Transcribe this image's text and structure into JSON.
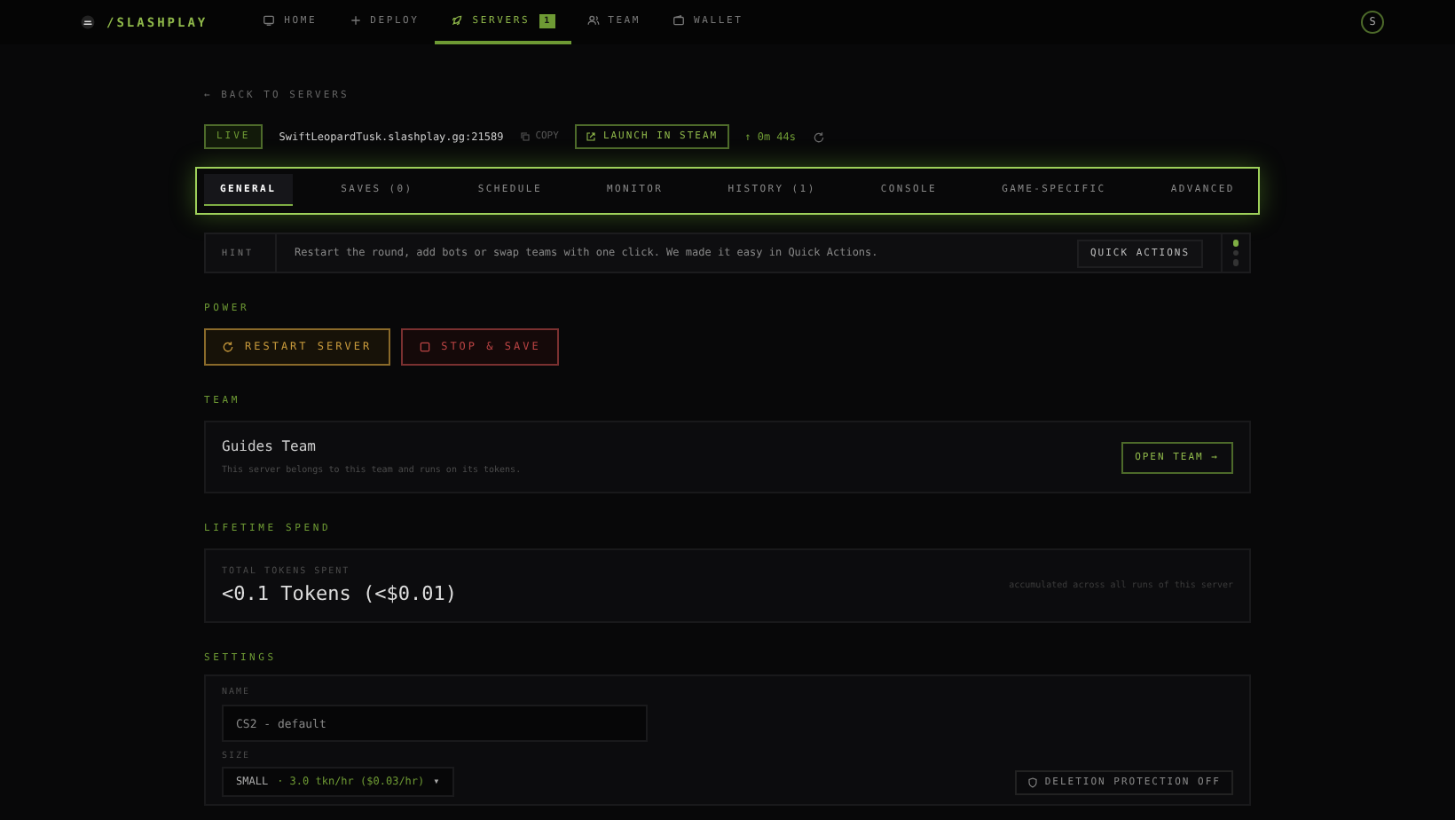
{
  "nav": {
    "brand": "/SLASHPLAY",
    "items": [
      {
        "label": "HOME",
        "selected": false
      },
      {
        "label": "DEPLOY",
        "selected": false
      },
      {
        "label": "SERVERS",
        "selected": true,
        "badge": "1"
      },
      {
        "label": "TEAM",
        "selected": false
      },
      {
        "label": "WALLET",
        "selected": false
      }
    ],
    "avatar": "S"
  },
  "back_link": "← BACK TO SERVERS",
  "server": {
    "status": "LIVE",
    "address": "SwiftLeopardTusk.slashplay.gg:21589",
    "copy": "COPY",
    "launch": "LAUNCH IN STEAM",
    "uptime": "↑ 0m 44s"
  },
  "tabs": [
    {
      "label": "GENERAL",
      "selected": true
    },
    {
      "label": "SAVES (0)",
      "selected": false
    },
    {
      "label": "SCHEDULE",
      "selected": false
    },
    {
      "label": "MONITOR",
      "selected": false
    },
    {
      "label": "HISTORY (1)",
      "selected": false
    },
    {
      "label": "CONSOLE",
      "selected": false
    },
    {
      "label": "GAME-SPECIFIC",
      "selected": false
    },
    {
      "label": "ADVANCED",
      "selected": false
    }
  ],
  "hint": {
    "tag": "HINT",
    "text": "Restart the round, add bots or swap teams with one click. We made it easy in Quick Actions.",
    "action": "QUICK ACTIONS",
    "pager": [
      {
        "selected": true
      },
      {
        "selected": false
      },
      {
        "selected": false
      }
    ]
  },
  "power": {
    "heading": "POWER",
    "buttons": [
      {
        "label": "RESTART SERVER",
        "kind": "restart"
      },
      {
        "label": "STOP & SAVE",
        "kind": "stop"
      }
    ]
  },
  "team": {
    "heading": "TEAM",
    "name": "Guides Team",
    "description": "This server belongs to this team and runs on its tokens.",
    "action": "OPEN TEAM →"
  },
  "lifetime_spend": {
    "heading": "LIFETIME SPEND",
    "label": "TOTAL TOKENS SPENT",
    "value": "<0.1 Tokens (<$0.01)",
    "note": "accumulated across all runs of this server"
  },
  "settings": {
    "heading": "SETTINGS",
    "name_label": "NAME",
    "name_value": "CS2 - default",
    "size_label": "SIZE",
    "size_tier": "SMALL",
    "size_value": "· 3.0 tkn/hr ($0.03/hr)",
    "size_caret": "▾",
    "protection": "DELETION PROTECTION OFF"
  }
}
